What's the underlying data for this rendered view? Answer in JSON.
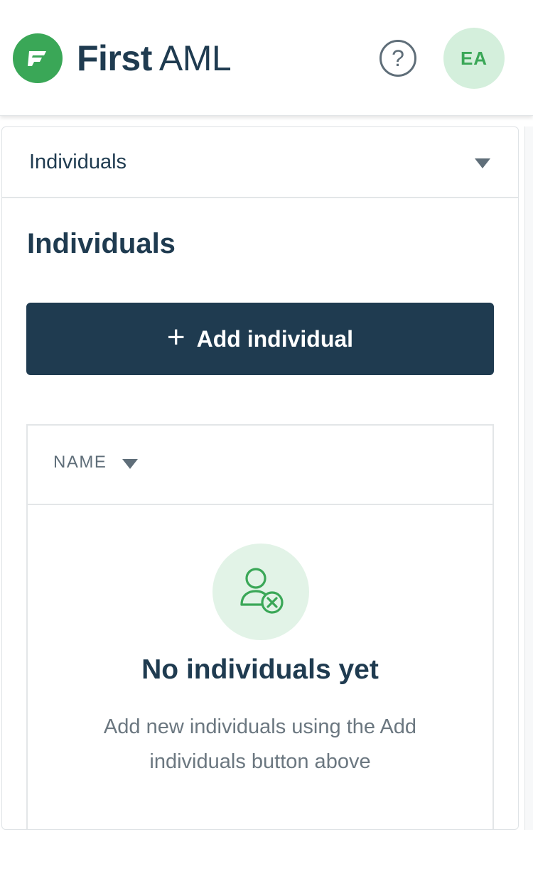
{
  "header": {
    "brand_bold": "First",
    "brand_light": "AML",
    "help_symbol": "?",
    "avatar_initials": "EA",
    "logo_icon": "first-aml-logo-icon",
    "help_icon": "help-circle-icon"
  },
  "section_selector": {
    "selected": "Individuals",
    "caret_icon": "caret-down-icon"
  },
  "main": {
    "title": "Individuals",
    "add_button": {
      "icon": "plus-icon",
      "icon_symbol": "+",
      "label": "Add individual"
    },
    "table": {
      "columns": [
        {
          "label": "NAME",
          "sort_icon": "caret-down-icon"
        }
      ],
      "empty_state": {
        "icon": "user-remove-icon",
        "title": "No individuals yet",
        "description": "Add new individuals using the Add individuals button above"
      }
    }
  },
  "colors": {
    "brand_green": "#3aa757",
    "navy": "#1f3b50",
    "avatar_bg": "#d4efdc",
    "empty_icon_bg": "#e2f3e7",
    "muted_text": "#6b7780"
  }
}
